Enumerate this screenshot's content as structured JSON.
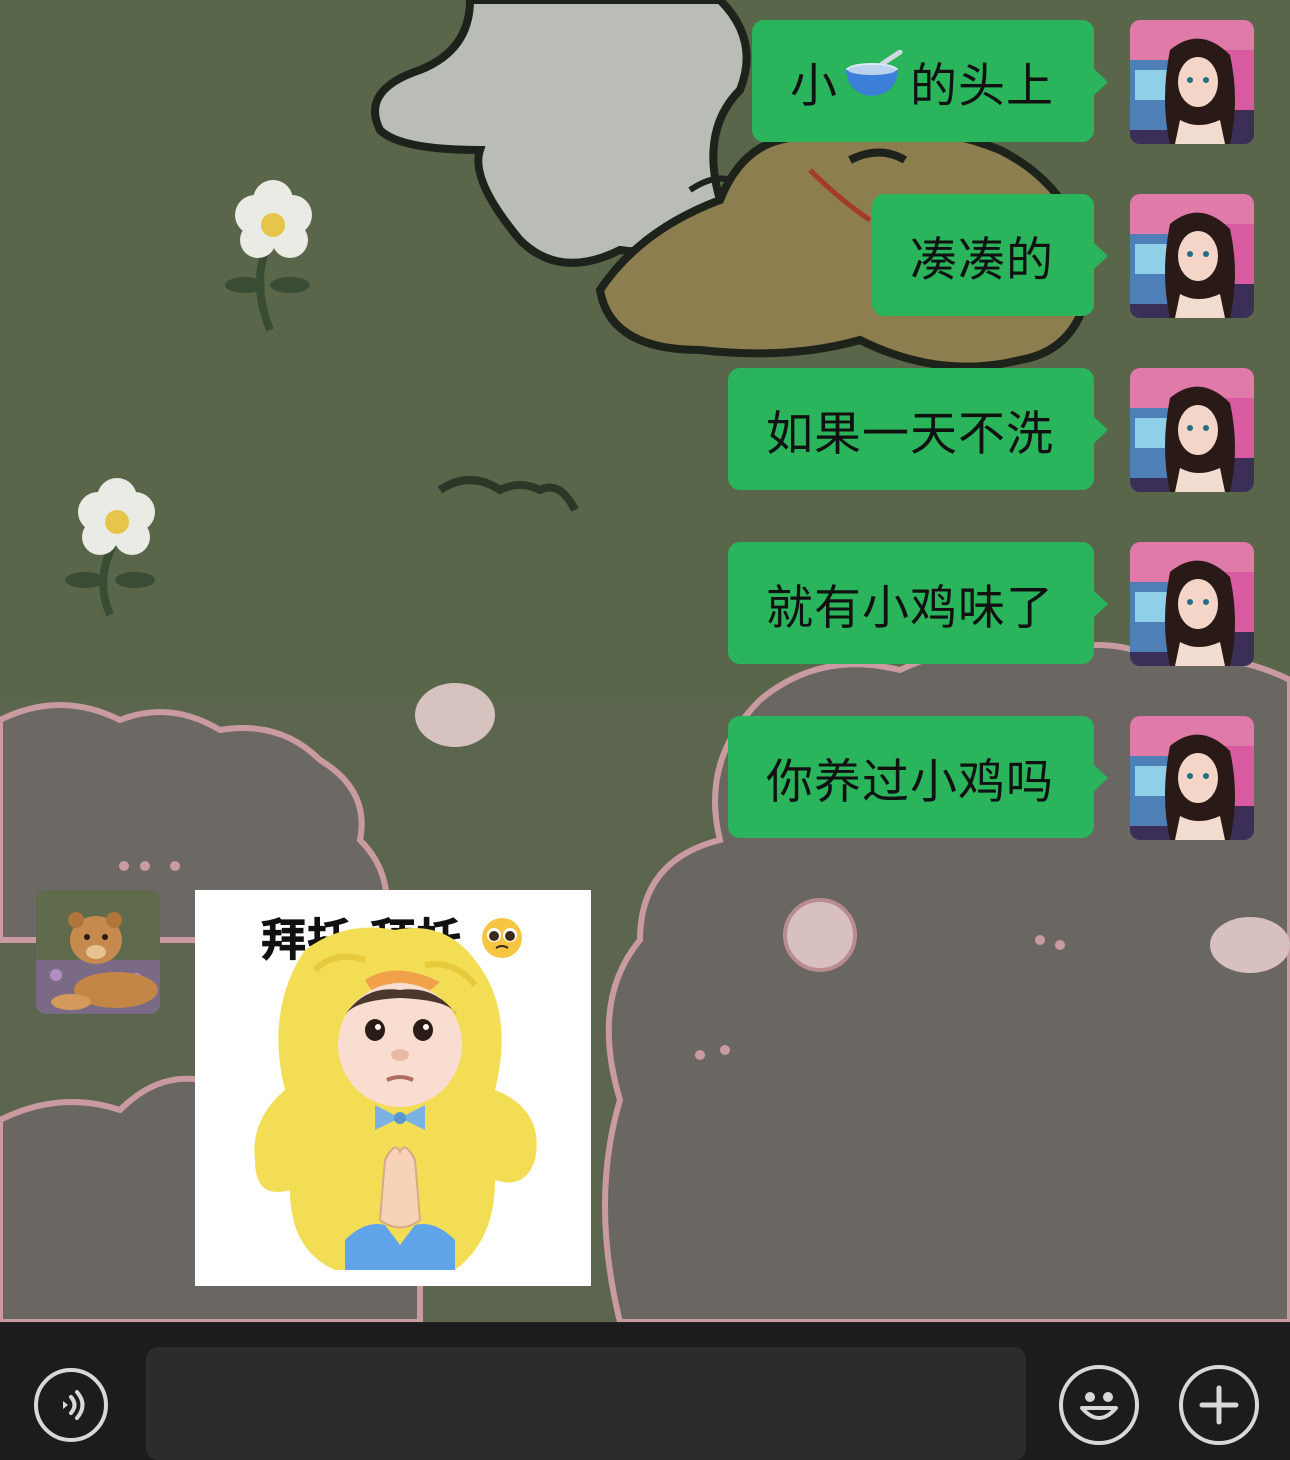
{
  "messages": [
    {
      "side": "right",
      "text_before": "小",
      "emoji": "bowl-with-spoon",
      "text_after": "的头上"
    },
    {
      "side": "right",
      "text": "凑凑的"
    },
    {
      "side": "right",
      "text": "如果一天不洗"
    },
    {
      "side": "right",
      "text": "就有小鸡味了"
    },
    {
      "side": "right",
      "text": "你养过小鸡吗"
    }
  ],
  "incoming": {
    "avatar": "lion-cub-photo",
    "sticker": {
      "caption": "拜托  拜托",
      "caption_emoji": "pleading-face",
      "image": "baby-in-yellow-chick-costume-praying-hands"
    }
  },
  "input_bar": {
    "voice_icon": "voice-icon",
    "input_value": "",
    "emoji_icon": "emoji-icon",
    "plus_icon": "plus-icon"
  },
  "colors": {
    "bubble": "#2ab55c",
    "wallpaper": "#586449",
    "bar": "#1c1c1c"
  }
}
